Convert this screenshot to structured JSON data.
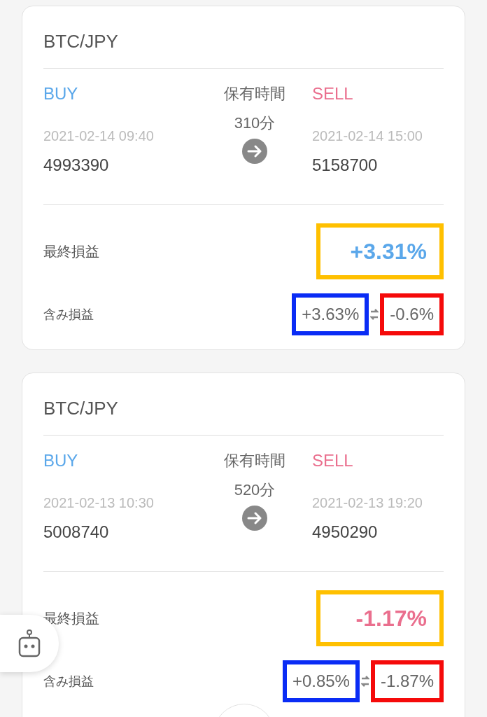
{
  "trades": [
    {
      "pair": "BTC/JPY",
      "buy": {
        "label": "BUY",
        "time": "2021-02-14 09:40",
        "price": "4993390"
      },
      "hold": {
        "label": "保有時間",
        "value": "310分"
      },
      "sell": {
        "label": "SELL",
        "time": "2021-02-14 15:00",
        "price": "5158700"
      },
      "final": {
        "label": "最終損益",
        "value": "+3.31%",
        "color": "#5aa7ea"
      },
      "unrealized": {
        "label": "含み損益",
        "buy_value": "+3.63%",
        "sell_value": "-0.6%"
      }
    },
    {
      "pair": "BTC/JPY",
      "buy": {
        "label": "BUY",
        "time": "2021-02-13 10:30",
        "price": "5008740"
      },
      "hold": {
        "label": "保有時間",
        "value": "520分"
      },
      "sell": {
        "label": "SELL",
        "time": "2021-02-13 19:20",
        "price": "4950290"
      },
      "final": {
        "label": "最終損益",
        "value": "-1.17%",
        "color": "#ea6f8e"
      },
      "unrealized": {
        "label": "含み損益",
        "buy_value": "+0.85%",
        "sell_value": "-1.87%"
      }
    }
  ]
}
